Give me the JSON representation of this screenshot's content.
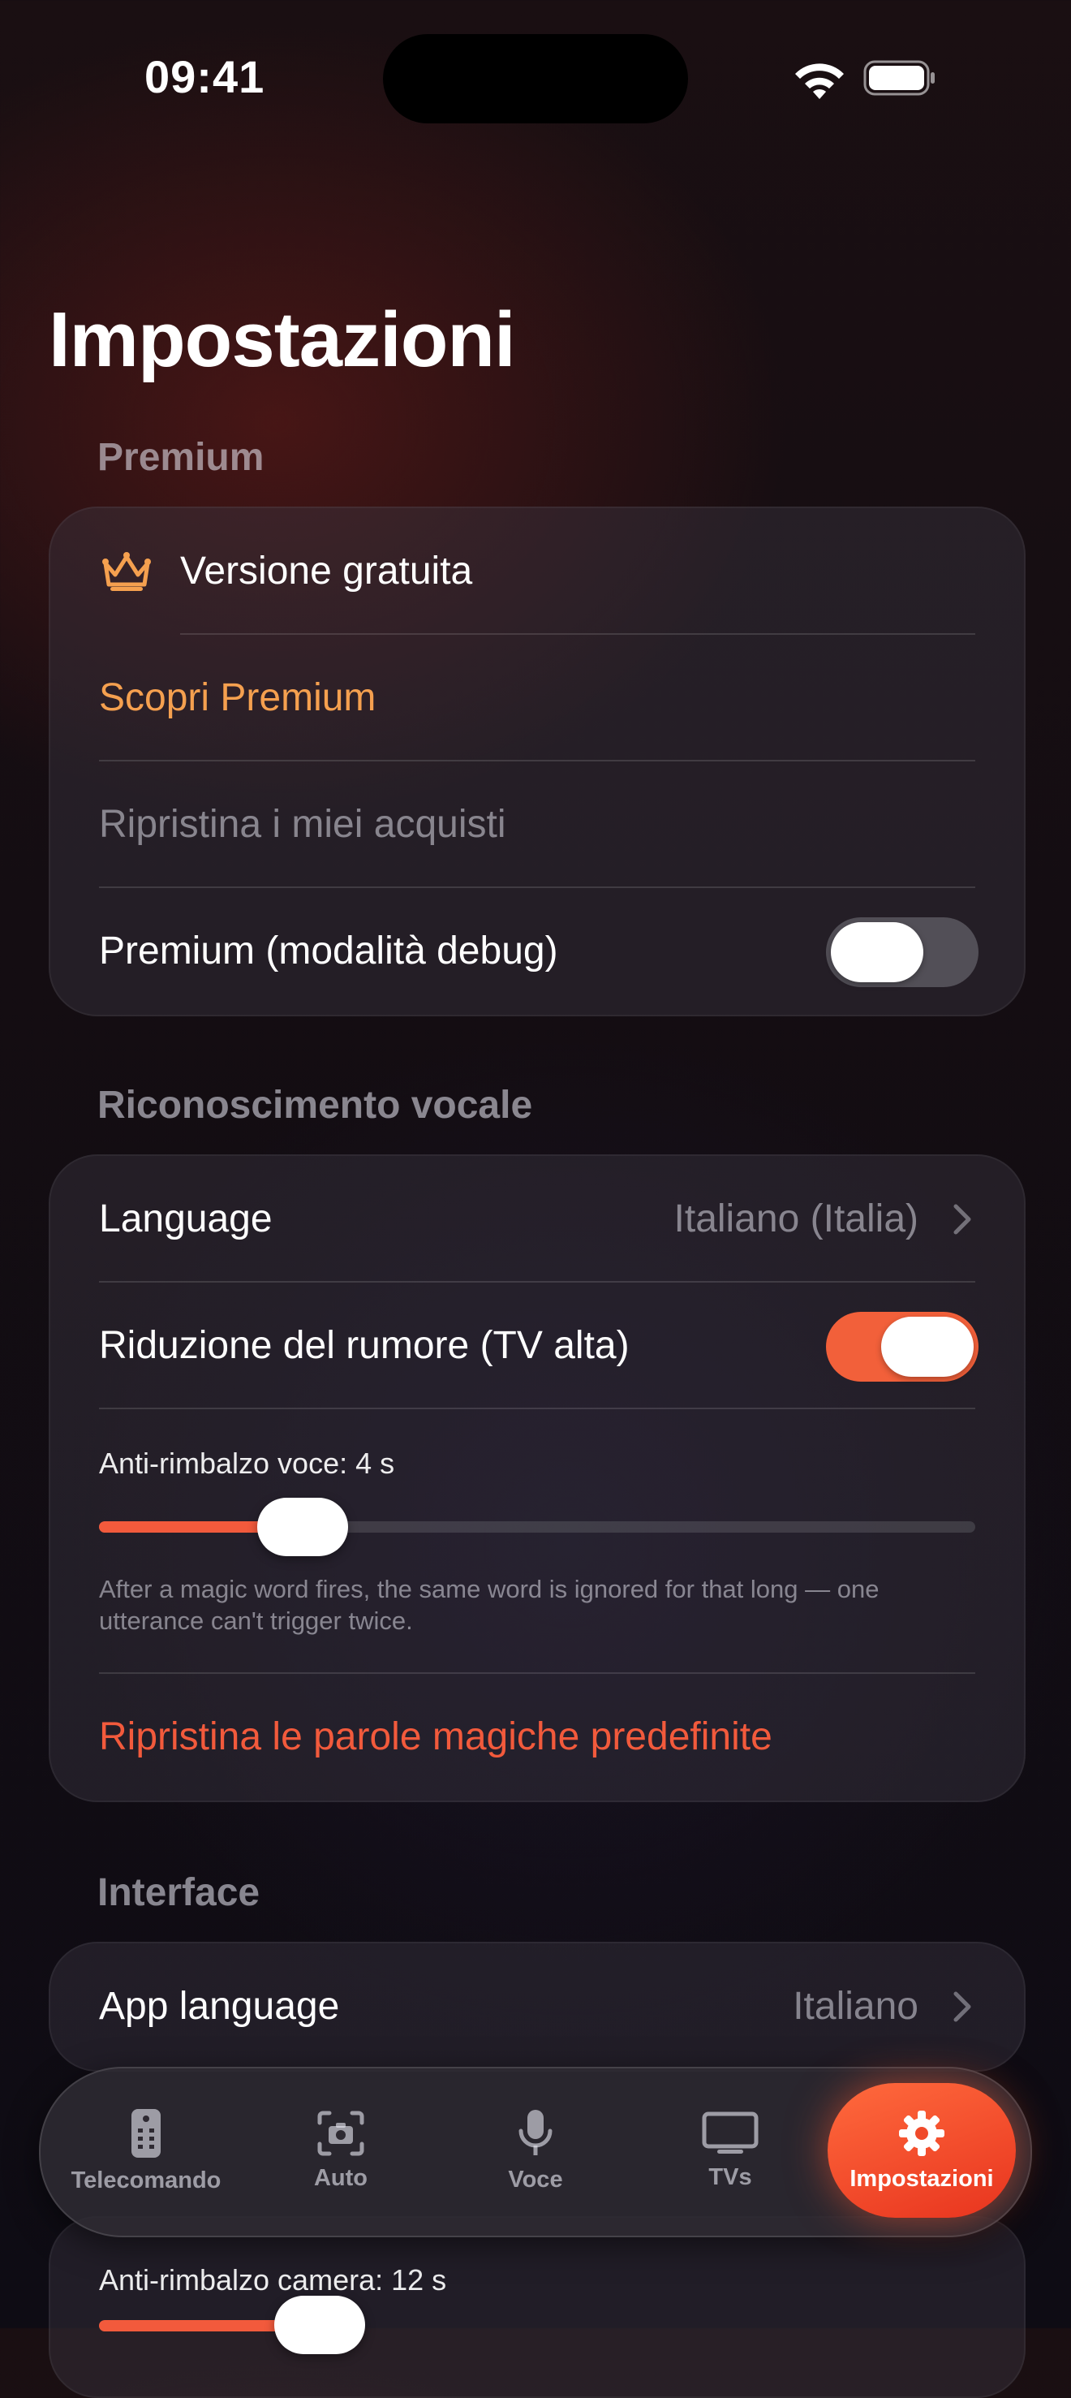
{
  "status_bar": {
    "time": "09:41"
  },
  "page_title": "Impostazioni",
  "premium": {
    "header": "Premium",
    "version_label": "Versione gratuita",
    "discover_label": "Scopri Premium",
    "restore_label": "Ripristina i miei acquisti",
    "debug_label": "Premium (modalità debug)",
    "debug_enabled": false
  },
  "voice": {
    "header": "Riconoscimento vocale",
    "language_label": "Language",
    "language_value": "Italiano (Italia)",
    "noise_label": "Riduzione del rumore (TV alta)",
    "noise_enabled": true,
    "debounce_label": "Anti-rimbalzo voce: 4 s",
    "debounce_value_s": 4,
    "debounce_fraction": 0.19,
    "debounce_help": "After a magic word fires, the same word is ignored for that long — one utterance can't trigger twice.",
    "reset_words_label": "Ripristina le parole magiche predefinite"
  },
  "interface": {
    "header": "Interface",
    "app_language_label": "App language",
    "app_language_value": "Italiano",
    "camera_debounce_label": "Anti-rimbalzo camera: 12 s",
    "camera_debounce_value_s": 12
  },
  "tabs": [
    {
      "label": "Telecomando",
      "icon": "remote-icon",
      "active": false
    },
    {
      "label": "Auto",
      "icon": "camera-scan-icon",
      "active": false
    },
    {
      "label": "Voce",
      "icon": "microphone-icon",
      "active": false
    },
    {
      "label": "TVs",
      "icon": "tv-icon",
      "active": false
    },
    {
      "label": "Impostazioni",
      "icon": "gear-icon",
      "active": true
    }
  ],
  "colors": {
    "accent": "#f25a3c",
    "premium_orange": "#f5a04f",
    "toggle_on": "#f2603a"
  }
}
